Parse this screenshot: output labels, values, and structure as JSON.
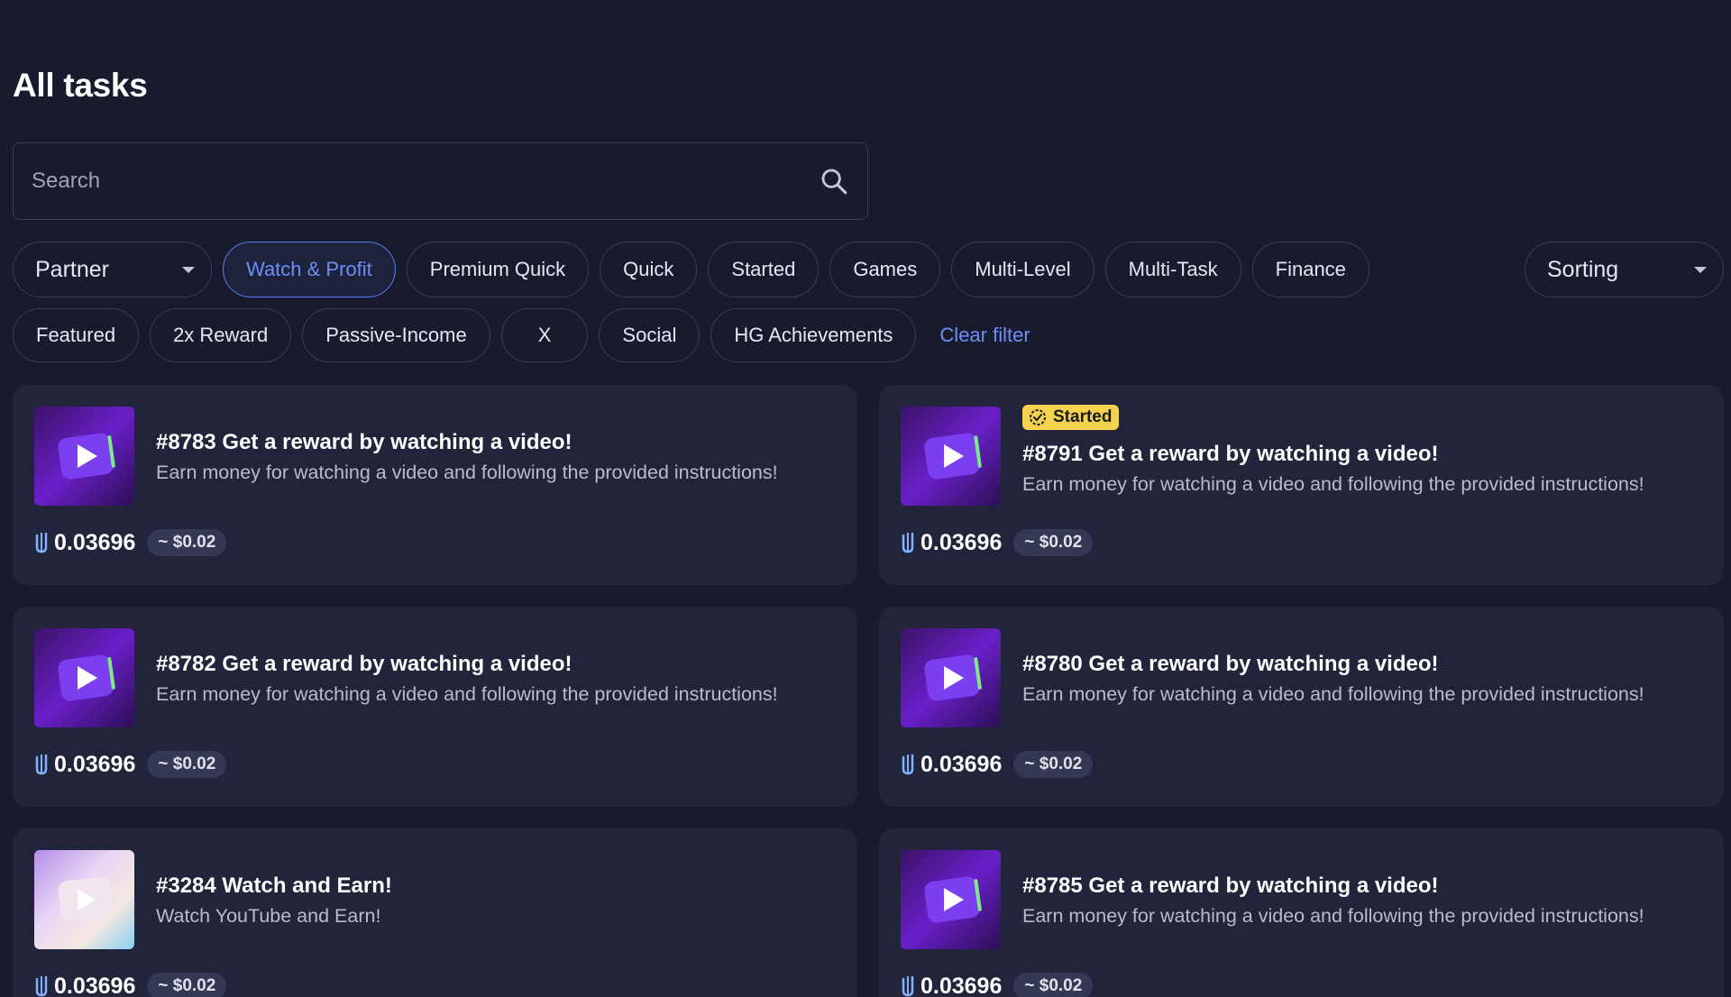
{
  "page": {
    "title": "All tasks"
  },
  "search": {
    "placeholder": "Search"
  },
  "filters": {
    "partner_label": "Partner",
    "sorting_label": "Sorting",
    "row1": [
      "Watch & Profit",
      "Premium Quick",
      "Quick",
      "Started",
      "Games",
      "Multi-Level",
      "Multi-Task",
      "Finance"
    ],
    "row2": [
      "Featured",
      "2x Reward",
      "Passive-Income",
      "X",
      "Social",
      "HG Achievements"
    ],
    "active": "Watch & Profit",
    "clear_label": "Clear filter"
  },
  "tasks": [
    {
      "title": "#8783 Get a reward by watching a video!",
      "description": "Earn money for watching a video and following the provided instructions!",
      "reward": "0.03696",
      "usd": "~ $0.02",
      "badge": "",
      "thumb": "purple"
    },
    {
      "title": "#8791 Get a reward by watching a video!",
      "description": "Earn money for watching a video and following the provided instructions!",
      "reward": "0.03696",
      "usd": "~ $0.02",
      "badge": "Started",
      "thumb": "purple"
    },
    {
      "title": "#8782 Get a reward by watching a video!",
      "description": "Earn money for watching a video and following the provided instructions!",
      "reward": "0.03696",
      "usd": "~ $0.02",
      "badge": "",
      "thumb": "purple"
    },
    {
      "title": "#8780 Get a reward by watching a video!",
      "description": "Earn money for watching a video and following the provided instructions!",
      "reward": "0.03696",
      "usd": "~ $0.02",
      "badge": "",
      "thumb": "purple"
    },
    {
      "title": "#3284 Watch and Earn!",
      "description": "Watch YouTube and Earn!",
      "reward": "0.03696",
      "usd": "~ $0.02",
      "badge": "",
      "thumb": "pastel"
    },
    {
      "title": "#8785 Get a reward by watching a video!",
      "description": "Earn money for watching a video and following the provided instructions!",
      "reward": "0.03696",
      "usd": "~ $0.02",
      "badge": "",
      "thumb": "purple"
    }
  ],
  "colors": {
    "background": "#181b2e",
    "card": "#21243a",
    "accent": "#6f8ff6",
    "badge": "#f5d34f"
  }
}
